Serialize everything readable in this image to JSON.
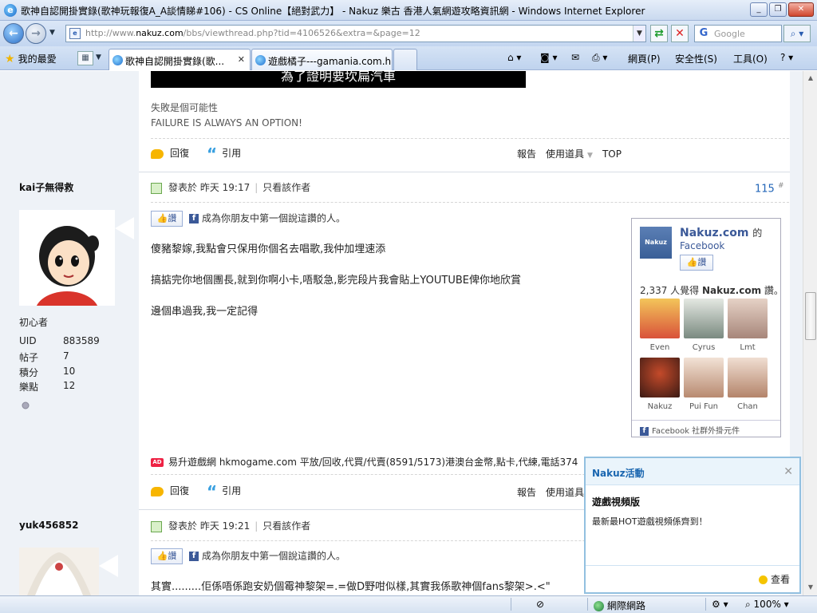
{
  "window": {
    "title": "歌神自認開掛實錄(歌神玩報復A_A談情睇#106) - CS Online【絕對武力】 - Nakuz 樂古 香港人氣網遊攻略資訊網 - Windows Internet Explorer"
  },
  "address_bar": {
    "url_prefix": "http://www.",
    "url_domain": "nakuz.com",
    "url_rest": "/bbs/viewthread.php?tid=4106526&extra=&page=12"
  },
  "search": {
    "placeholder": "Google"
  },
  "favorites_label": "我的最愛",
  "tabs": [
    {
      "label": "歌神自認開掛實錄(歌...",
      "active": true
    },
    {
      "label": "遊戲橘子---gamania.com.hk",
      "active": false
    }
  ],
  "toolbar_right": {
    "page": "網頁(P)",
    "safety": "安全性(S)",
    "tools": "工具(O)"
  },
  "prev_post": {
    "banner_text": "為了證明要坎扁汽車",
    "sig_line1": "失敗是個可能性",
    "sig_line2": "FAILURE IS ALWAYS AN OPTION!"
  },
  "actions": {
    "reply": "回復",
    "quote": "引用",
    "report": "報告",
    "tools": "使用道具",
    "top": "TOP"
  },
  "post1": {
    "author": "kai子無得救",
    "rank": "初心者",
    "stats": [
      {
        "k": "UID",
        "v": "883589"
      },
      {
        "k": "帖子",
        "v": "7"
      },
      {
        "k": "積分",
        "v": "10"
      },
      {
        "k": "樂點",
        "v": "12"
      }
    ],
    "posted_prefix": "發表於",
    "posted_time": "昨天 19:17",
    "only_author": "只看該作者",
    "floor": "115",
    "floor_mark": "#",
    "like_label": "讚",
    "fb_text": "成為你朋友中第一個說這讚的人。",
    "lines": [
      "傻豬黎嫁,我點會只保用你個名去唱歌,我仲加埋速添",
      "搞掂完你地個團長,就到你啊小卡,唔駁急,影完段片我會貼上YOUTUBE俾你地欣賞",
      "邊個串過我,我一定記得"
    ]
  },
  "fb_box": {
    "logo_text": "Nakuz",
    "name": "Nakuz.com",
    "name_suffix": "的",
    "sub": "Facebook",
    "like_label": "讚",
    "count_text": "2,337 人覺得",
    "count_name": "Nakuz.com",
    "count_suffix": "讚。",
    "faces": [
      {
        "name": "Even",
        "color": "#d98a3a"
      },
      {
        "name": "Cyrus",
        "color": "#9aa7a0"
      },
      {
        "name": "Lmt",
        "color": "#c9a89a"
      },
      {
        "name": "Nakuz",
        "color": "#8a3a2a"
      },
      {
        "name": "Pui Fun",
        "color": "#d7b8a6"
      },
      {
        "name": "Chan",
        "color": "#cfa996"
      }
    ],
    "footer": "Facebook 社群外掛元件"
  },
  "ad_line": "易升遊戲網 hkmogame.com 平放/回收,代買/代賣(8591/5173)港澳台金幣,點卡,代練,電話374",
  "post2": {
    "author": "yuk456852",
    "posted_prefix": "發表於",
    "posted_time": "昨天 19:21",
    "only_author": "只看該作者",
    "like_label": "讚",
    "fb_text": "成為你朋友中第一個說這讚的人。",
    "line": "其實.........佢係唔係跑安奶個霉神黎架=.=做D野咁似樣,其實我係歌神個fans黎架>.<\""
  },
  "popup": {
    "title": "Nakuz活動",
    "name": "遊戲視頻版",
    "desc": "最新最HOT遊戲視頻係齊到！",
    "view": "查看"
  },
  "statusbar": {
    "zone": "網際網路",
    "zoom": "100%"
  }
}
